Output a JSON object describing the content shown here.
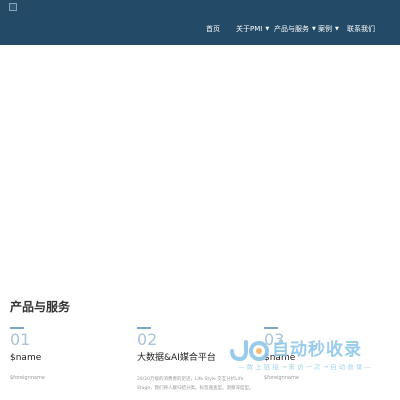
{
  "header": {
    "nav": [
      {
        "label": "首页",
        "has_dropdown": false
      },
      {
        "label": "关于PMI",
        "has_dropdown": true
      },
      {
        "label": "产品与服务",
        "has_dropdown": true
      },
      {
        "label": "案例",
        "has_dropdown": true
      },
      {
        "label": "联系我们",
        "has_dropdown": false
      }
    ],
    "caret": "▼"
  },
  "products": {
    "section_title": "产品与服务",
    "cards": [
      {
        "number": "01",
        "name": "$name",
        "sub": "$foreignname"
      },
      {
        "number": "02",
        "name": "大数据&AI媒合平台",
        "description": "28/20万级的消费者的足迹，Life Style 交互分析Life Stage，我们将人群归结分类，标签遍查型，洞察深度型。"
      },
      {
        "number": "03",
        "name": "$name",
        "sub": "$foreignname"
      }
    ]
  },
  "watermark": {
    "title": "自动秒收录",
    "subtitle": "— 数 上 链 接 → 来 访 一 次 → 自 动 收 录 —"
  },
  "colors": {
    "nav_bg": "#234a66",
    "accent": "#7aa7c7",
    "watermark": "#8ec6e8"
  }
}
